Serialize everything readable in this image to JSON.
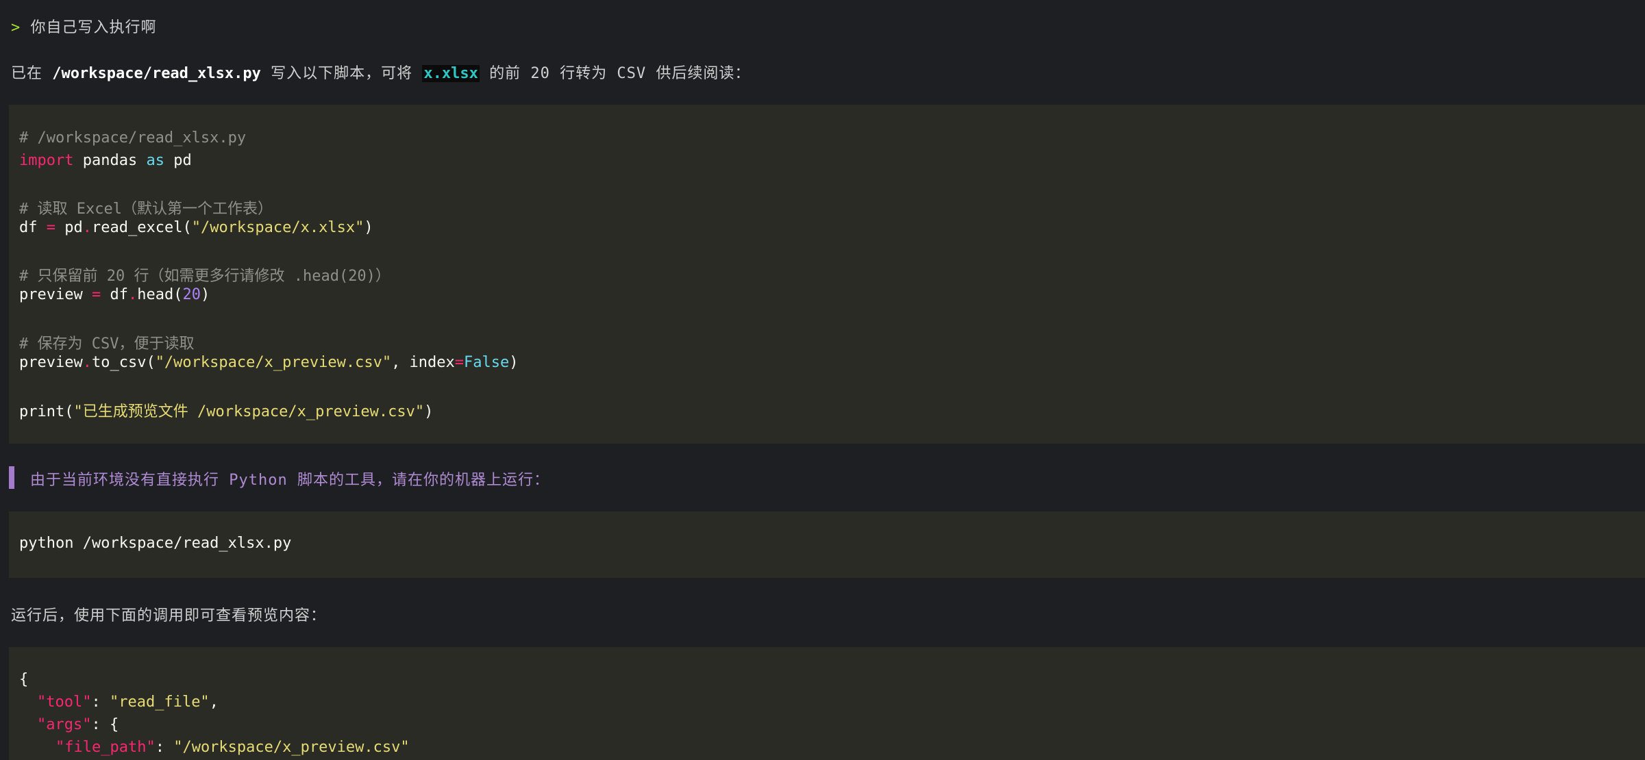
{
  "prompt": {
    "marker": ">",
    "text": " 你自己写入执行啊"
  },
  "intro": {
    "before": "已在 ",
    "path": "/workspace/read_xlsx.py",
    "middle": " 写入以下脚本，可将 ",
    "file": "x.xlsx",
    "after": " 的前 20 行转为 CSV 供后续阅读："
  },
  "code1": {
    "comment_path": "# /workspace/read_xlsx.py",
    "import_kw": "import",
    "import_mod": " pandas ",
    "as_kw": "as",
    "alias": " pd",
    "comment_read": "# 读取 Excel（默认第一个工作表）",
    "df_var": "df ",
    "eq1": "=",
    "pd_name": " pd",
    "dot1": ".",
    "read_fn": "read_excel(",
    "xlsx_str": "\"/workspace/x.xlsx\"",
    "close1": ")",
    "comment_keep": "# 只保留前 20 行（如需更多行请修改 .head(20)）",
    "preview_var": "preview ",
    "eq2": "=",
    "df_name": " df",
    "dot2": ".",
    "head_fn": "head(",
    "head_num": "20",
    "close2": ")",
    "comment_save": "# 保存为 CSV，便于读取",
    "preview_name": "preview",
    "dot3": ".",
    "to_csv_fn": "to_csv(",
    "csv_str": "\"/workspace/x_preview.csv\"",
    "index_arg": ", index",
    "eq3": "=",
    "false_kw": "False",
    "close3": ")",
    "print_fn": "print(",
    "print_str": "\"已生成预览文件 /workspace/x_preview.csv\"",
    "close4": ")"
  },
  "note": "由于当前环境没有直接执行 Python 脚本的工具，请在你的机器上运行：",
  "code2": {
    "command": "python /workspace/read_xlsx.py"
  },
  "after_text": "运行后，使用下面的调用即可查看预览内容：",
  "code3": {
    "open_brace": "{",
    "tool_key": "\"tool\"",
    "colon1": ": ",
    "tool_val": "\"read_file\"",
    "comma1": ",",
    "args_key": "\"args\"",
    "args_open": ": {",
    "path_key": "\"file_path\"",
    "colon2": ": ",
    "path_val": "\"/workspace/x_preview.csv\""
  },
  "colors": {
    "background": "#1e1f22",
    "code_background": "#2a2b24",
    "keyword": "#f92672",
    "string": "#e6db74",
    "number": "#ae81ff",
    "builtin": "#66d9ef",
    "comment": "#8f908a",
    "quote_bar": "#a37acc",
    "inline_code": "#2ec6c6"
  }
}
